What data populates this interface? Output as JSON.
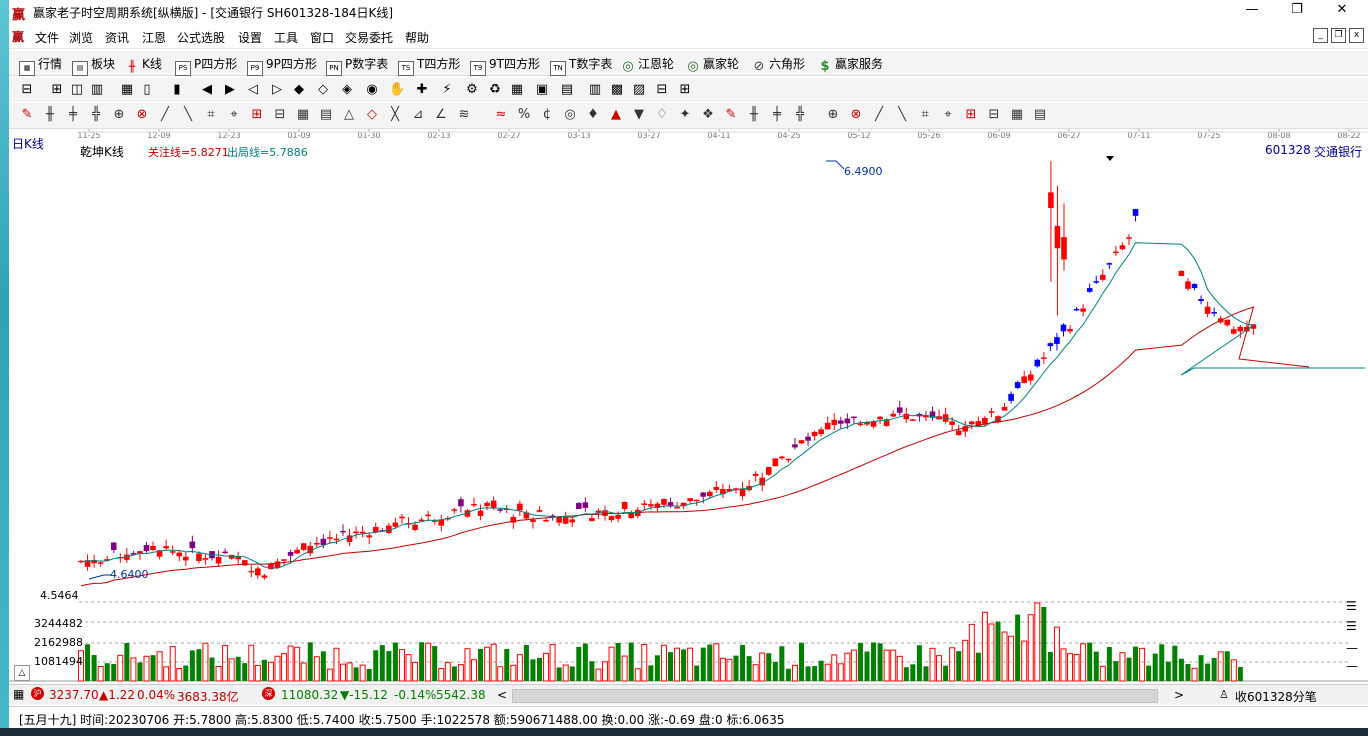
{
  "window": {
    "title": "赢家老子时空周期系统[纵横版] - [交通银行  SH601328-184日K线]",
    "controls": [
      "—",
      "❐",
      "✕"
    ]
  },
  "menu": {
    "items": [
      "文件",
      "浏览",
      "资讯",
      "江恩",
      "公式选股",
      "设置",
      "工具",
      "窗口",
      "交易委托",
      "帮助"
    ],
    "mdi_controls": [
      "_",
      "❐",
      "x"
    ]
  },
  "toolbar": {
    "items": [
      {
        "label": "行情",
        "icon": "grid-icon",
        "glyph": "▦"
      },
      {
        "label": "板块",
        "icon": "blocks-icon",
        "glyph": "▤"
      },
      {
        "label": "K线",
        "icon": "kline-icon",
        "glyph": "╫"
      },
      {
        "label": "P四方形",
        "icon": "ps-icon",
        "glyph": "PS"
      },
      {
        "label": "9P四方形",
        "icon": "p9-icon",
        "glyph": "P9"
      },
      {
        "label": "P数字表",
        "icon": "pn-icon",
        "glyph": "PN"
      },
      {
        "label": "T四方形",
        "icon": "ts-icon",
        "glyph": "TS"
      },
      {
        "label": "9T四方形",
        "icon": "t9-icon",
        "glyph": "T9"
      },
      {
        "label": "T数字表",
        "icon": "tn-icon",
        "glyph": "TN"
      },
      {
        "label": "江恩轮",
        "icon": "gann-wheel-icon",
        "glyph": "◎"
      },
      {
        "label": "赢家轮",
        "icon": "winner-wheel-icon",
        "glyph": "◎"
      },
      {
        "label": "六角形",
        "icon": "hexagon-icon",
        "glyph": "⊘"
      },
      {
        "label": "赢家服务",
        "icon": "dollar-icon",
        "glyph": "$"
      }
    ]
  },
  "chart": {
    "period_label": "日K线",
    "indicator_name": "乾坤K线",
    "focus_line": "关注线=5.8271",
    "exit_line": "出局线=5.7886",
    "stock_code": "601328",
    "stock_name": "交通银行",
    "high_marker": "6.4900",
    "low_marker": "4.6400",
    "price_floor_label": "4.5464",
    "volume_axis": [
      "3244482",
      "2162988",
      "1081494"
    ],
    "date_axis": [
      "11-25",
      "12-09",
      "12-23",
      "01-09",
      "01-30",
      "02-13",
      "02-27",
      "03-13",
      "03-27",
      "04-11",
      "04-25",
      "05-12",
      "05-26",
      "06-09",
      "06-27",
      "07-11",
      "07-25",
      "08-08",
      "08-22"
    ],
    "colors": {
      "up": "#ff0000",
      "down": "#008000",
      "down_candle": "#0000ff",
      "neutral": "#800080",
      "ma_short": "#008080",
      "ma_long": "#c00000"
    }
  },
  "statusbar": {
    "sh_index": "3237.70",
    "sh_change": "▲1.22",
    "sh_pct": "0.04%",
    "sh_amount": "3683.38亿",
    "sz_index": "11080.32",
    "sz_change": "▼-15.12",
    "sz_pct": "-0.14%",
    "sz_amount": "5542.38",
    "scroll_left": "<",
    "scroll_right": ">",
    "sh_badge": "沪",
    "sz_badge": "深",
    "right_text": "收601328分笔"
  },
  "infobar": {
    "text": "[五月十九] 时间:20230706 开:5.7800 高:5.8300 低:5.7400 收:5.7500 手:1022578 额:590671488.00 换:0.00 涨:-0.69 盘:0 标:6.0635"
  }
}
